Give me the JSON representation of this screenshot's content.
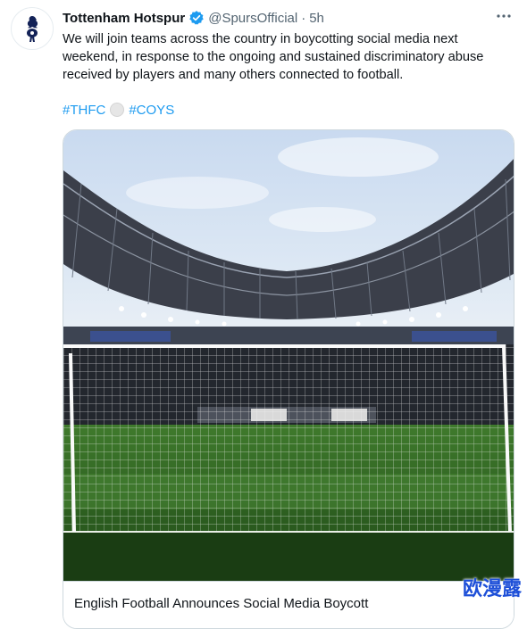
{
  "tweet": {
    "author": {
      "display_name": "Tottenham Hotspur",
      "handle": "@SpursOfficial",
      "verified": true,
      "avatar_icon": "spurs-cockerel-logo-icon"
    },
    "separator": "·",
    "timestamp": "5h",
    "text": "We will join teams across the country in boycotting social media next weekend, in response to the ongoing and sustained discriminatory abuse received by players and many others connected to football.",
    "hashtags": [
      "#THFC",
      "#COYS"
    ],
    "emoji_between_hashtags": "white-circle-emoji",
    "card": {
      "image": "stadium-goal-net-photo",
      "title": "English Football Announces Social Media Boycott"
    }
  },
  "watermark": "欧漫露",
  "colors": {
    "text": "#0f1419",
    "secondary": "#536471",
    "link": "#1d9bf0",
    "verified": "#1d9bf0",
    "border": "#cfd9de",
    "watermark": "#1d4fd8"
  }
}
